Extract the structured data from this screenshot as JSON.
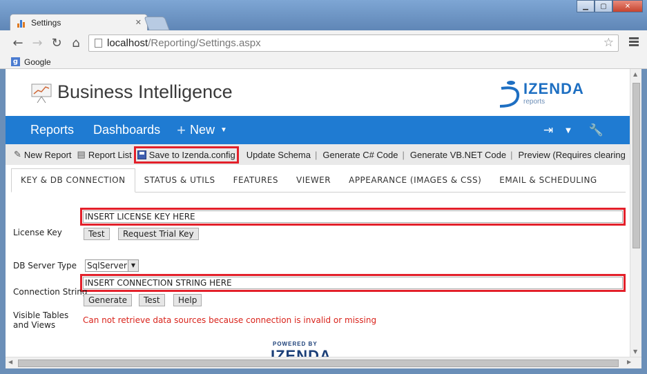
{
  "browser": {
    "tab_title": "Settings",
    "url_host": "localhost",
    "url_path": "/Reporting/Settings.aspx",
    "bookmark": "Google"
  },
  "header": {
    "title": "Business Intelligence",
    "logo_word": "IZENDA",
    "logo_sub": "reports"
  },
  "navbar": {
    "reports": "Reports",
    "dashboards": "Dashboards",
    "new": "New"
  },
  "actions": {
    "new_report": "New Report",
    "report_list": "Report List",
    "save_config": "Save to Izenda.config",
    "update_schema": "Update Schema",
    "gen_cs": "Generate C# Code",
    "gen_vb": "Generate VB.NET Code",
    "preview": "Preview (Requires clearing"
  },
  "tabs": [
    "KEY & DB CONNECTION",
    "STATUS & UTILS",
    "FEATURES",
    "VIEWER",
    "APPEARANCE (IMAGES & CSS)",
    "EMAIL & SCHEDULING"
  ],
  "form": {
    "license_label": "License Key",
    "license_value": "INSERT LICENSE KEY HERE",
    "test": "Test",
    "request_trial": "Request Trial Key",
    "db_type_label": "DB Server Type",
    "db_type_value": "SqlServer",
    "conn_label": "Connection String",
    "conn_value": "INSERT CONNECTION STRING HERE",
    "generate": "Generate",
    "test2": "Test",
    "help": "Help",
    "visible_label_1": "Visible Tables",
    "visible_label_2": "and Views",
    "error": "Can not retrieve data sources because connection is invalid or missing"
  },
  "powered": {
    "small": "POWERED BY",
    "big": "IZENDA"
  },
  "colors": {
    "nav_blue": "#1f7bd2",
    "highlight_red": "#e3202a",
    "error_red": "#d9231b"
  }
}
